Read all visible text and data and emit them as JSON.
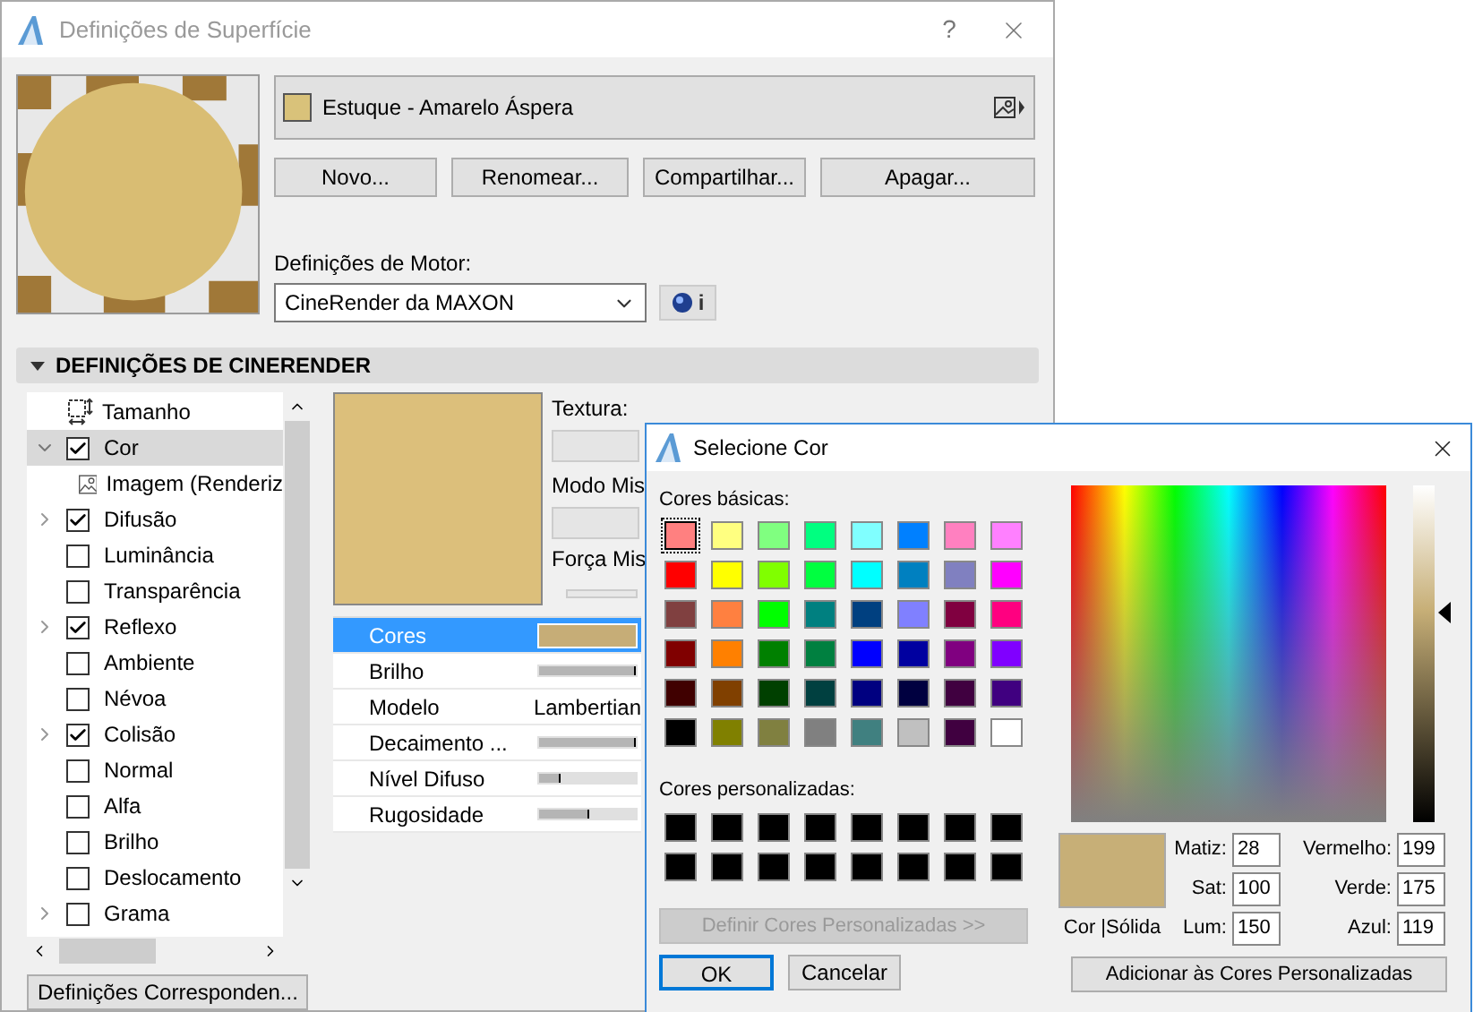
{
  "window": {
    "title": "Definições de Superfície",
    "help": "?"
  },
  "surface": {
    "name": "Estuque - Amarelo Áspera",
    "color": "#d9c27a"
  },
  "buttons": [
    "Novo...",
    "Renomear...",
    "Compartilhar...",
    "Apagar..."
  ],
  "engine": {
    "label": "Definições de Motor:",
    "value": "CineRender da MAXON",
    "info": "i"
  },
  "section": {
    "title": "DEFINIÇÕES DE CINERENDER",
    "expanded": true
  },
  "tree": [
    {
      "kind": "size",
      "label": "Tamanho",
      "selected": false
    },
    {
      "kind": "checkbox",
      "label": "Cor",
      "checked": true,
      "expanded": true,
      "selected": true,
      "children": [
        {
          "kind": "image",
          "label": "Imagem (Renderiz",
          "selected": false
        }
      ]
    },
    {
      "kind": "checkbox",
      "label": "Difusão",
      "checked": true,
      "expanded": false,
      "selected": false
    },
    {
      "kind": "checkbox",
      "label": "Luminância",
      "checked": false,
      "selected": false
    },
    {
      "kind": "checkbox",
      "label": "Transparência",
      "checked": false,
      "selected": false
    },
    {
      "kind": "checkbox",
      "label": "Reflexo",
      "checked": true,
      "expanded": false,
      "selected": false
    },
    {
      "kind": "checkbox",
      "label": "Ambiente",
      "checked": false,
      "selected": false
    },
    {
      "kind": "checkbox",
      "label": "Névoa",
      "checked": false,
      "selected": false
    },
    {
      "kind": "checkbox",
      "label": "Colisão",
      "checked": true,
      "expanded": false,
      "selected": false
    },
    {
      "kind": "checkbox",
      "label": "Normal",
      "checked": false,
      "selected": false
    },
    {
      "kind": "checkbox",
      "label": "Alfa",
      "checked": false,
      "selected": false
    },
    {
      "kind": "checkbox",
      "label": "Brilho",
      "checked": false,
      "selected": false
    },
    {
      "kind": "checkbox",
      "label": "Deslocamento",
      "checked": false,
      "selected": false
    },
    {
      "kind": "checkbox",
      "label": "Grama",
      "checked": false,
      "expanded": false,
      "selected": false
    }
  ],
  "matching_button": "Definições Corresponden...",
  "texture": {
    "texture_label": "Textura:",
    "blend_label": "Modo Mis",
    "strength_label": "Força Mis",
    "strength_slider": {
      "level": 0
    }
  },
  "properties": [
    {
      "kind": "color",
      "label": "Cores",
      "color": "#c6ad77",
      "selected": true
    },
    {
      "kind": "slider",
      "label": "Brilho",
      "level": 1,
      "selected": false
    },
    {
      "kind": "text",
      "label": "Modelo",
      "value": "Lambertian",
      "selected": false
    },
    {
      "kind": "slider",
      "label": "Decaimento ...",
      "level": 1,
      "selected": false
    },
    {
      "kind": "slider",
      "label": "Nível Difuso",
      "level": 0.22,
      "selected": false
    },
    {
      "kind": "slider",
      "label": "Rugosidade",
      "level": 0.52,
      "selected": false
    }
  ],
  "color_dialog": {
    "title": "Selecione Cor",
    "basic_label": "Cores básicas:",
    "basic_colors": [
      {
        "color": "#ff8080",
        "selected": true
      },
      {
        "color": "#ffff80",
        "selected": false
      },
      {
        "color": "#80ff80",
        "selected": false
      },
      {
        "color": "#00ff80",
        "selected": false
      },
      {
        "color": "#80ffff",
        "selected": false
      },
      {
        "color": "#0080ff",
        "selected": false
      },
      {
        "color": "#ff80c0",
        "selected": false
      },
      {
        "color": "#ff80ff",
        "selected": false
      },
      {
        "color": "#ff0000",
        "selected": false
      },
      {
        "color": "#ffff00",
        "selected": false
      },
      {
        "color": "#80ff00",
        "selected": false
      },
      {
        "color": "#00ff40",
        "selected": false
      },
      {
        "color": "#00ffff",
        "selected": false
      },
      {
        "color": "#0080c0",
        "selected": false
      },
      {
        "color": "#8080c0",
        "selected": false
      },
      {
        "color": "#ff00ff",
        "selected": false
      },
      {
        "color": "#804040",
        "selected": false
      },
      {
        "color": "#ff8040",
        "selected": false
      },
      {
        "color": "#00ff00",
        "selected": false
      },
      {
        "color": "#008080",
        "selected": false
      },
      {
        "color": "#004080",
        "selected": false
      },
      {
        "color": "#8080ff",
        "selected": false
      },
      {
        "color": "#800040",
        "selected": false
      },
      {
        "color": "#ff0080",
        "selected": false
      },
      {
        "color": "#800000",
        "selected": false
      },
      {
        "color": "#ff8000",
        "selected": false
      },
      {
        "color": "#008000",
        "selected": false
      },
      {
        "color": "#008040",
        "selected": false
      },
      {
        "color": "#0000ff",
        "selected": false
      },
      {
        "color": "#0000a0",
        "selected": false
      },
      {
        "color": "#800080",
        "selected": false
      },
      {
        "color": "#8000ff",
        "selected": false
      },
      {
        "color": "#400000",
        "selected": false
      },
      {
        "color": "#804000",
        "selected": false
      },
      {
        "color": "#004000",
        "selected": false
      },
      {
        "color": "#004040",
        "selected": false
      },
      {
        "color": "#000080",
        "selected": false
      },
      {
        "color": "#000040",
        "selected": false
      },
      {
        "color": "#400040",
        "selected": false
      },
      {
        "color": "#400080",
        "selected": false
      },
      {
        "color": "#000000",
        "selected": false
      },
      {
        "color": "#808000",
        "selected": false
      },
      {
        "color": "#808040",
        "selected": false
      },
      {
        "color": "#808080",
        "selected": false
      },
      {
        "color": "#408080",
        "selected": false
      },
      {
        "color": "#c0c0c0",
        "selected": false
      },
      {
        "color": "#400040",
        "selected": false
      },
      {
        "color": "#ffffff",
        "selected": false
      }
    ],
    "custom_label": "Cores personalizadas:",
    "custom_colors": [
      {
        "color": "#000000",
        "selected": false
      },
      {
        "color": "#000000",
        "selected": false
      },
      {
        "color": "#000000",
        "selected": false
      },
      {
        "color": "#000000",
        "selected": false
      },
      {
        "color": "#000000",
        "selected": false
      },
      {
        "color": "#000000",
        "selected": false
      },
      {
        "color": "#000000",
        "selected": false
      },
      {
        "color": "#000000",
        "selected": false
      },
      {
        "color": "#000000",
        "selected": false
      },
      {
        "color": "#000000",
        "selected": false
      },
      {
        "color": "#000000",
        "selected": false
      },
      {
        "color": "#000000",
        "selected": false
      },
      {
        "color": "#000000",
        "selected": false
      },
      {
        "color": "#000000",
        "selected": false
      },
      {
        "color": "#000000",
        "selected": false
      },
      {
        "color": "#000000",
        "selected": false
      }
    ],
    "define_button": {
      "label": "Definir Cores Personalizadas >>",
      "disabled": true
    },
    "ok": "OK",
    "cancel": "Cancelar",
    "current_label": "Cor |Sólida",
    "hsl": [
      {
        "label": "Matiz:",
        "value": "28"
      },
      {
        "label": "Sat:",
        "value": "100"
      },
      {
        "label": "Lum:",
        "value": "150"
      }
    ],
    "rgb": [
      {
        "label": "Vermelho:",
        "value": "199"
      },
      {
        "label": "Verde:",
        "value": "175"
      },
      {
        "label": "Azul:",
        "value": "119"
      }
    ],
    "add_button": "Adicionar às Cores Personalizadas"
  }
}
